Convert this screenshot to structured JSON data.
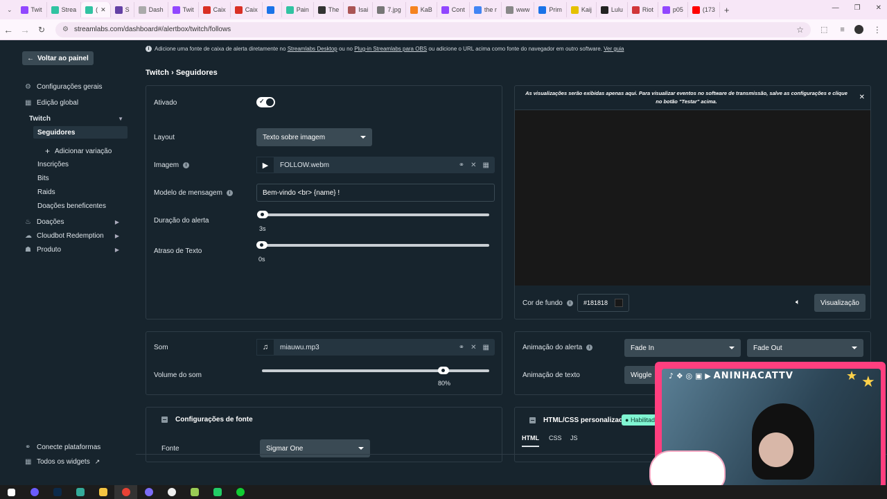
{
  "browser": {
    "tabs": [
      {
        "label": "Twit",
        "color": "#9146ff"
      },
      {
        "label": "Strea",
        "color": "#31c3a2"
      },
      {
        "label": "(",
        "color": "#31c3a2"
      },
      {
        "label": "S",
        "color": "#6441a5"
      },
      {
        "label": "Dash",
        "color": "#aaa"
      },
      {
        "label": "Twit",
        "color": "#9146ff"
      },
      {
        "label": "Caix",
        "color": "#d93025"
      },
      {
        "label": "Caix",
        "color": "#d93025"
      },
      {
        "label": "",
        "color": "#1a73e8"
      },
      {
        "label": "Pain",
        "color": "#31c3a2"
      },
      {
        "label": "The",
        "color": "#333"
      },
      {
        "label": "Isai",
        "color": "#a55"
      },
      {
        "label": "7.jpg",
        "color": "#777"
      },
      {
        "label": "KaB",
        "color": "#f58220"
      },
      {
        "label": "Cont",
        "color": "#9146ff"
      },
      {
        "label": "the r",
        "color": "#4285f4"
      },
      {
        "label": "www",
        "color": "#888"
      },
      {
        "label": "Prim",
        "color": "#1a73e8"
      },
      {
        "label": "Kaij",
        "color": "#e5c100"
      },
      {
        "label": "Lulu",
        "color": "#222"
      },
      {
        "label": "Riot",
        "color": "#d13639"
      },
      {
        "label": "p05",
        "color": "#9146ff"
      },
      {
        "label": "(173",
        "color": "#ff0000"
      }
    ],
    "url": "streamlabs.com/dashboard#/alertbox/twitch/follows"
  },
  "sidebar": {
    "back": "Voltar ao painel",
    "items": [
      {
        "label": "Configurações gerais",
        "icon": "gear-icon"
      },
      {
        "label": "Edição global",
        "icon": "grid-icon"
      },
      {
        "label": "Twitch"
      },
      {
        "label": "Seguidores"
      },
      {
        "label": "Adicionar variação"
      },
      {
        "label": "Inscrições"
      },
      {
        "label": "Bits"
      },
      {
        "label": "Raids"
      },
      {
        "label": "Doações beneficentes"
      },
      {
        "label": "Doações",
        "icon": "donations-icon"
      },
      {
        "label": "Cloudbot Redemption",
        "icon": "cloudbot-icon"
      },
      {
        "label": "Produto",
        "icon": "product-icon"
      }
    ],
    "connect": "Conecte plataformas",
    "widgets": "Todos os widgets"
  },
  "notice": {
    "pre": "Adicione uma fonte de caixa de alerta diretamente no ",
    "link1": "Streamlabs Desktop",
    "mid": " ou no ",
    "link2": "Plug-in Streamlabs para OBS",
    "post": " ou adicione o URL acima como fonte do navegador em outro software. ",
    "link3": "Ver guia"
  },
  "breadcrumb": {
    "platform": "Twitch",
    "sep": "›",
    "page": "Seguidores"
  },
  "form": {
    "enabled_label": "Ativado",
    "layout_label": "Layout",
    "layout_value": "Texto sobre imagem",
    "image_label": "Imagem",
    "image_file": "FOLLOW.webm",
    "message_label": "Modelo de mensagem",
    "message_value": "Bem-vindo <br> {name} !",
    "duration_label": "Duração do alerta",
    "duration_value": "3s",
    "text_delay_label": "Atraso de Texto",
    "text_delay_value": "0s",
    "sound_label": "Som",
    "sound_file": "miauwu.mp3",
    "volume_label": "Volume do som",
    "volume_value": "80%",
    "volume_fraction": 0.8,
    "font_section": "Configurações de fonte",
    "font_label": "Fonte",
    "font_value": "Sigmar One"
  },
  "preview": {
    "note": "As visualizações serão exibidas apenas aqui. Para visualizar eventos no software de transmissão, salve as configurações e clique no botão \"Testar\" acima.",
    "bg_label": "Cor de fundo",
    "bg_value": "#181818",
    "preview_btn": "Visualização",
    "alert_anim_label": "Animação do alerta",
    "anim_in": "Fade In",
    "anim_out": "Fade Out",
    "text_anim_label": "Animação de texto",
    "text_anim_value": "Wiggle",
    "custom_label": "HTML/CSS personalizado",
    "custom_badge": "Habilitado",
    "tabs": [
      "HTML",
      "CSS",
      "JS"
    ]
  },
  "overlay": {
    "channel": "ANINHACATTV"
  }
}
